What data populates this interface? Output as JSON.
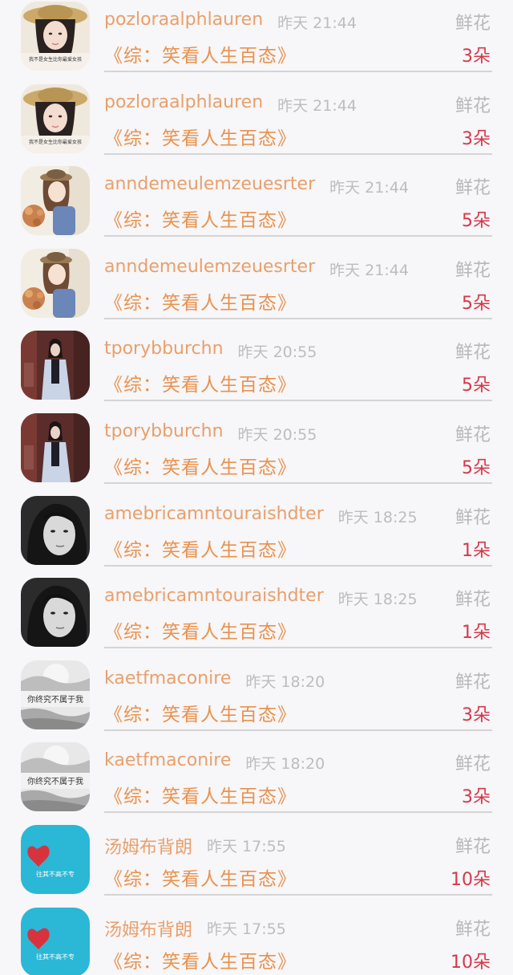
{
  "gift_label": "鲜花",
  "book_title": "《综：笑看人生百态》",
  "items": [
    {
      "username": "pozloraalphlauren",
      "time": "昨天 21:44",
      "count": "3朵",
      "avatar": "girl-hat-avatar"
    },
    {
      "username": "pozloraalphlauren",
      "time": "昨天 21:44",
      "count": "3朵",
      "avatar": "girl-hat-avatar"
    },
    {
      "username": "anndemeulemzeuesrter",
      "time": "昨天 21:44",
      "count": "5朵",
      "avatar": "girl-flowers-avatar"
    },
    {
      "username": "anndemeulemzeuesrter",
      "time": "昨天 21:44",
      "count": "5朵",
      "avatar": "girl-flowers-avatar"
    },
    {
      "username": "tporybburchn",
      "time": "昨天 20:55",
      "count": "5朵",
      "avatar": "woman-street-avatar"
    },
    {
      "username": "tporybburchn",
      "time": "昨天 20:55",
      "count": "5朵",
      "avatar": "woman-street-avatar"
    },
    {
      "username": "amebricamntouraishdter",
      "time": "昨天 18:25",
      "count": "1朵",
      "avatar": "bw-portrait-avatar"
    },
    {
      "username": "amebricamntouraishdter",
      "time": "昨天 18:25",
      "count": "1朵",
      "avatar": "bw-portrait-avatar"
    },
    {
      "username": "kaetfmaconire",
      "time": "昨天 18:20",
      "count": "3朵",
      "avatar": "text-scenery-avatar"
    },
    {
      "username": "kaetfmaconire",
      "time": "昨天 18:20",
      "count": "3朵",
      "avatar": "text-scenery-avatar"
    },
    {
      "username": "汤姆布背朗",
      "time": "昨天 17:55",
      "count": "10朵",
      "avatar": "heart-blue-avatar"
    },
    {
      "username": "汤姆布背朗",
      "time": "昨天 17:55",
      "count": "10朵",
      "avatar": "heart-blue-avatar"
    }
  ],
  "avatar_texts": {
    "girl_hat": "我不是女生比你最爱女孩",
    "text_scenery": "你终究不属于我",
    "heart_blue": "往其不高不专"
  }
}
